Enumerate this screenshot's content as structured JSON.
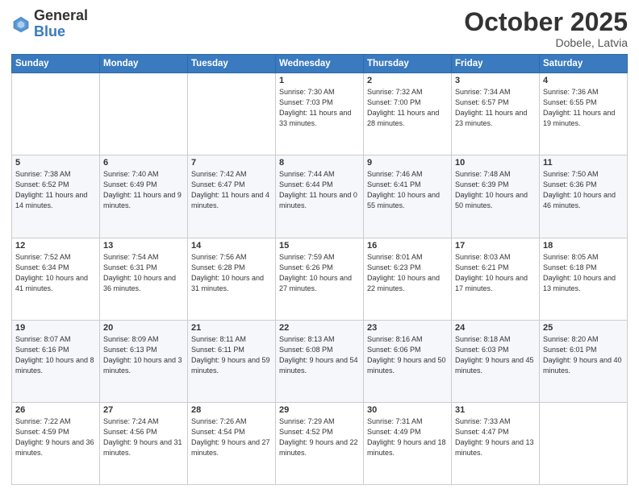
{
  "header": {
    "logo_general": "General",
    "logo_blue": "Blue",
    "month": "October 2025",
    "location": "Dobele, Latvia"
  },
  "weekdays": [
    "Sunday",
    "Monday",
    "Tuesday",
    "Wednesday",
    "Thursday",
    "Friday",
    "Saturday"
  ],
  "weeks": [
    [
      {
        "day": "",
        "sunrise": "",
        "sunset": "",
        "daylight": ""
      },
      {
        "day": "",
        "sunrise": "",
        "sunset": "",
        "daylight": ""
      },
      {
        "day": "",
        "sunrise": "",
        "sunset": "",
        "daylight": ""
      },
      {
        "day": "1",
        "sunrise": "Sunrise: 7:30 AM",
        "sunset": "Sunset: 7:03 PM",
        "daylight": "Daylight: 11 hours and 33 minutes."
      },
      {
        "day": "2",
        "sunrise": "Sunrise: 7:32 AM",
        "sunset": "Sunset: 7:00 PM",
        "daylight": "Daylight: 11 hours and 28 minutes."
      },
      {
        "day": "3",
        "sunrise": "Sunrise: 7:34 AM",
        "sunset": "Sunset: 6:57 PM",
        "daylight": "Daylight: 11 hours and 23 minutes."
      },
      {
        "day": "4",
        "sunrise": "Sunrise: 7:36 AM",
        "sunset": "Sunset: 6:55 PM",
        "daylight": "Daylight: 11 hours and 19 minutes."
      }
    ],
    [
      {
        "day": "5",
        "sunrise": "Sunrise: 7:38 AM",
        "sunset": "Sunset: 6:52 PM",
        "daylight": "Daylight: 11 hours and 14 minutes."
      },
      {
        "day": "6",
        "sunrise": "Sunrise: 7:40 AM",
        "sunset": "Sunset: 6:49 PM",
        "daylight": "Daylight: 11 hours and 9 minutes."
      },
      {
        "day": "7",
        "sunrise": "Sunrise: 7:42 AM",
        "sunset": "Sunset: 6:47 PM",
        "daylight": "Daylight: 11 hours and 4 minutes."
      },
      {
        "day": "8",
        "sunrise": "Sunrise: 7:44 AM",
        "sunset": "Sunset: 6:44 PM",
        "daylight": "Daylight: 11 hours and 0 minutes."
      },
      {
        "day": "9",
        "sunrise": "Sunrise: 7:46 AM",
        "sunset": "Sunset: 6:41 PM",
        "daylight": "Daylight: 10 hours and 55 minutes."
      },
      {
        "day": "10",
        "sunrise": "Sunrise: 7:48 AM",
        "sunset": "Sunset: 6:39 PM",
        "daylight": "Daylight: 10 hours and 50 minutes."
      },
      {
        "day": "11",
        "sunrise": "Sunrise: 7:50 AM",
        "sunset": "Sunset: 6:36 PM",
        "daylight": "Daylight: 10 hours and 46 minutes."
      }
    ],
    [
      {
        "day": "12",
        "sunrise": "Sunrise: 7:52 AM",
        "sunset": "Sunset: 6:34 PM",
        "daylight": "Daylight: 10 hours and 41 minutes."
      },
      {
        "day": "13",
        "sunrise": "Sunrise: 7:54 AM",
        "sunset": "Sunset: 6:31 PM",
        "daylight": "Daylight: 10 hours and 36 minutes."
      },
      {
        "day": "14",
        "sunrise": "Sunrise: 7:56 AM",
        "sunset": "Sunset: 6:28 PM",
        "daylight": "Daylight: 10 hours and 31 minutes."
      },
      {
        "day": "15",
        "sunrise": "Sunrise: 7:59 AM",
        "sunset": "Sunset: 6:26 PM",
        "daylight": "Daylight: 10 hours and 27 minutes."
      },
      {
        "day": "16",
        "sunrise": "Sunrise: 8:01 AM",
        "sunset": "Sunset: 6:23 PM",
        "daylight": "Daylight: 10 hours and 22 minutes."
      },
      {
        "day": "17",
        "sunrise": "Sunrise: 8:03 AM",
        "sunset": "Sunset: 6:21 PM",
        "daylight": "Daylight: 10 hours and 17 minutes."
      },
      {
        "day": "18",
        "sunrise": "Sunrise: 8:05 AM",
        "sunset": "Sunset: 6:18 PM",
        "daylight": "Daylight: 10 hours and 13 minutes."
      }
    ],
    [
      {
        "day": "19",
        "sunrise": "Sunrise: 8:07 AM",
        "sunset": "Sunset: 6:16 PM",
        "daylight": "Daylight: 10 hours and 8 minutes."
      },
      {
        "day": "20",
        "sunrise": "Sunrise: 8:09 AM",
        "sunset": "Sunset: 6:13 PM",
        "daylight": "Daylight: 10 hours and 3 minutes."
      },
      {
        "day": "21",
        "sunrise": "Sunrise: 8:11 AM",
        "sunset": "Sunset: 6:11 PM",
        "daylight": "Daylight: 9 hours and 59 minutes."
      },
      {
        "day": "22",
        "sunrise": "Sunrise: 8:13 AM",
        "sunset": "Sunset: 6:08 PM",
        "daylight": "Daylight: 9 hours and 54 minutes."
      },
      {
        "day": "23",
        "sunrise": "Sunrise: 8:16 AM",
        "sunset": "Sunset: 6:06 PM",
        "daylight": "Daylight: 9 hours and 50 minutes."
      },
      {
        "day": "24",
        "sunrise": "Sunrise: 8:18 AM",
        "sunset": "Sunset: 6:03 PM",
        "daylight": "Daylight: 9 hours and 45 minutes."
      },
      {
        "day": "25",
        "sunrise": "Sunrise: 8:20 AM",
        "sunset": "Sunset: 6:01 PM",
        "daylight": "Daylight: 9 hours and 40 minutes."
      }
    ],
    [
      {
        "day": "26",
        "sunrise": "Sunrise: 7:22 AM",
        "sunset": "Sunset: 4:59 PM",
        "daylight": "Daylight: 9 hours and 36 minutes."
      },
      {
        "day": "27",
        "sunrise": "Sunrise: 7:24 AM",
        "sunset": "Sunset: 4:56 PM",
        "daylight": "Daylight: 9 hours and 31 minutes."
      },
      {
        "day": "28",
        "sunrise": "Sunrise: 7:26 AM",
        "sunset": "Sunset: 4:54 PM",
        "daylight": "Daylight: 9 hours and 27 minutes."
      },
      {
        "day": "29",
        "sunrise": "Sunrise: 7:29 AM",
        "sunset": "Sunset: 4:52 PM",
        "daylight": "Daylight: 9 hours and 22 minutes."
      },
      {
        "day": "30",
        "sunrise": "Sunrise: 7:31 AM",
        "sunset": "Sunset: 4:49 PM",
        "daylight": "Daylight: 9 hours and 18 minutes."
      },
      {
        "day": "31",
        "sunrise": "Sunrise: 7:33 AM",
        "sunset": "Sunset: 4:47 PM",
        "daylight": "Daylight: 9 hours and 13 minutes."
      },
      {
        "day": "",
        "sunrise": "",
        "sunset": "",
        "daylight": ""
      }
    ]
  ]
}
